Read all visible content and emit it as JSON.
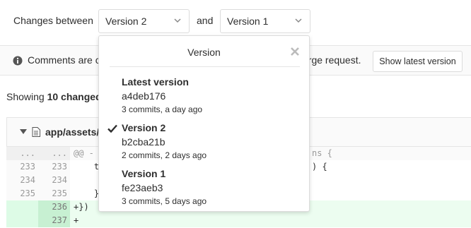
{
  "compare": {
    "label": "Changes between",
    "from_version": "Version 2",
    "and_label": "and",
    "to_version": "Version 1"
  },
  "info_bar": {
    "text_start": "Comments are c",
    "text_end": "erge request.",
    "button_label": "Show latest version"
  },
  "summary": {
    "prefix": "Showing ",
    "bold": "10 changed"
  },
  "file": {
    "path": "app/assets/"
  },
  "diff": {
    "rows": [
      {
        "old": "...",
        "new": "...",
        "code": "@@ -",
        "code_right": "ns {",
        "type": "match"
      },
      {
        "old": "233",
        "new": "233",
        "code": "    t",
        "code_right": ") {",
        "type": "plain"
      },
      {
        "old": "234",
        "new": "234",
        "code": "",
        "code_right": "",
        "type": "plain"
      },
      {
        "old": "235",
        "new": "235",
        "code": "    }",
        "code_right": "",
        "type": "plain"
      },
      {
        "old": "",
        "new": "236",
        "code": "+})",
        "code_right": "",
        "type": "added"
      },
      {
        "old": "",
        "new": "237",
        "code": "+",
        "code_right": "",
        "type": "added"
      }
    ]
  },
  "dropdown": {
    "title": "Version",
    "close_icon": "close-icon",
    "items": [
      {
        "name": "Latest version",
        "sha": "a4deb176",
        "meta": "3 commits, a day ago",
        "selected": false
      },
      {
        "name": "Version 2",
        "sha": "b2cba21b",
        "meta": "2 commits, 2 days ago",
        "selected": true
      },
      {
        "name": "Version 1",
        "sha": "fe23aeb3",
        "meta": "3 commits, 5 days ago",
        "selected": false
      }
    ]
  },
  "colors": {
    "added_row": "#ecfdf0",
    "added_line_number": "#c7f0d2",
    "border": "#dcdcdc"
  }
}
